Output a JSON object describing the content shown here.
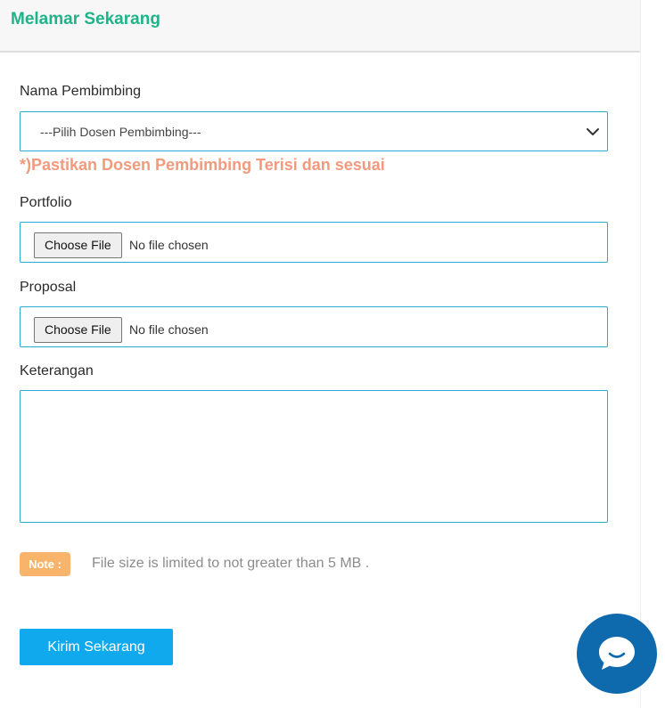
{
  "header": {
    "title": "Melamar Sekarang"
  },
  "form": {
    "advisor": {
      "label": "Nama Pembimbing",
      "selected": "---Pilih Dosen Pembimbing---",
      "warning": "*)Pastikan Dosen Pembimbing Terisi dan sesuai"
    },
    "portfolio": {
      "label": "Portfolio",
      "button": "Choose File",
      "status": "No file chosen"
    },
    "proposal": {
      "label": "Proposal",
      "button": "Choose File",
      "status": "No file chosen"
    },
    "notes": {
      "label": "Keterangan",
      "value": ""
    },
    "note": {
      "badge": "Note :",
      "text": "File size is limited to not greater than 5 MB ."
    },
    "submit": {
      "label": "Kirim Sekarang"
    }
  },
  "chat": {
    "icon": "chat-bubble-icon"
  },
  "colors": {
    "accent_green": "#1fb389",
    "border_blue": "#2ba9d1",
    "warning": "#f19a7d",
    "note_badge": "#f7b46a",
    "submit": "#11a9ee",
    "chat": "#0e6aad"
  }
}
